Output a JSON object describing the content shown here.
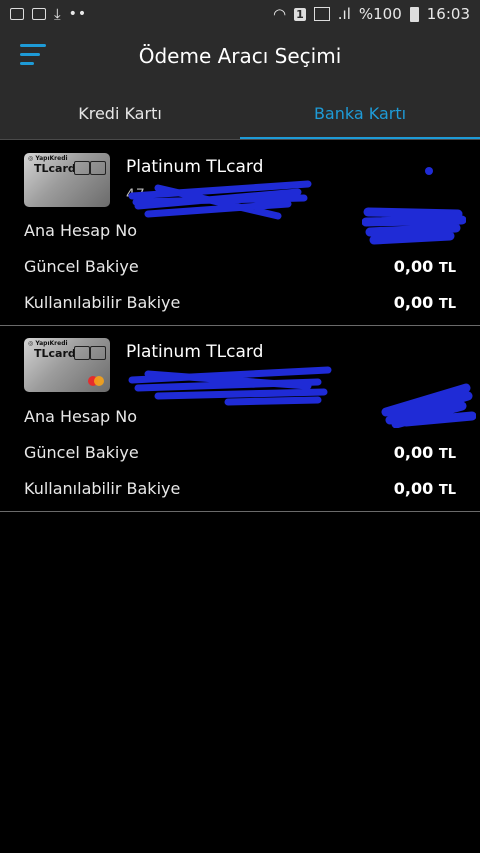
{
  "status_bar": {
    "battery": "%100",
    "time": "16:03",
    "sim": "1"
  },
  "header": {
    "title": "Ödeme Aracı Seçimi"
  },
  "tabs": [
    {
      "label": "Kredi Kartı",
      "active": false
    },
    {
      "label": "Banka Kartı",
      "active": true
    }
  ],
  "cards": [
    {
      "name": "Platinum TLcard",
      "number_visible": "47",
      "account_label": "Ana Hesap No",
      "current_label": "Güncel Bakiye",
      "current_value": "0,00",
      "current_currency": "TL",
      "available_label": "Kullanılabilir Bakiye",
      "available_value": "0,00",
      "available_currency": "TL"
    },
    {
      "name": "Platinum TLcard",
      "number_visible": "",
      "account_label": "Ana Hesap No",
      "current_label": "Güncel Bakiye",
      "current_value": "0,00",
      "current_currency": "TL",
      "available_label": "Kullanılabilir Bakiye",
      "available_value": "0,00",
      "available_currency": "TL"
    }
  ],
  "colors": {
    "accent": "#1e9bd7",
    "header_bg": "#2b2b2b",
    "background": "#000000",
    "redaction": "#1f2bd6"
  }
}
